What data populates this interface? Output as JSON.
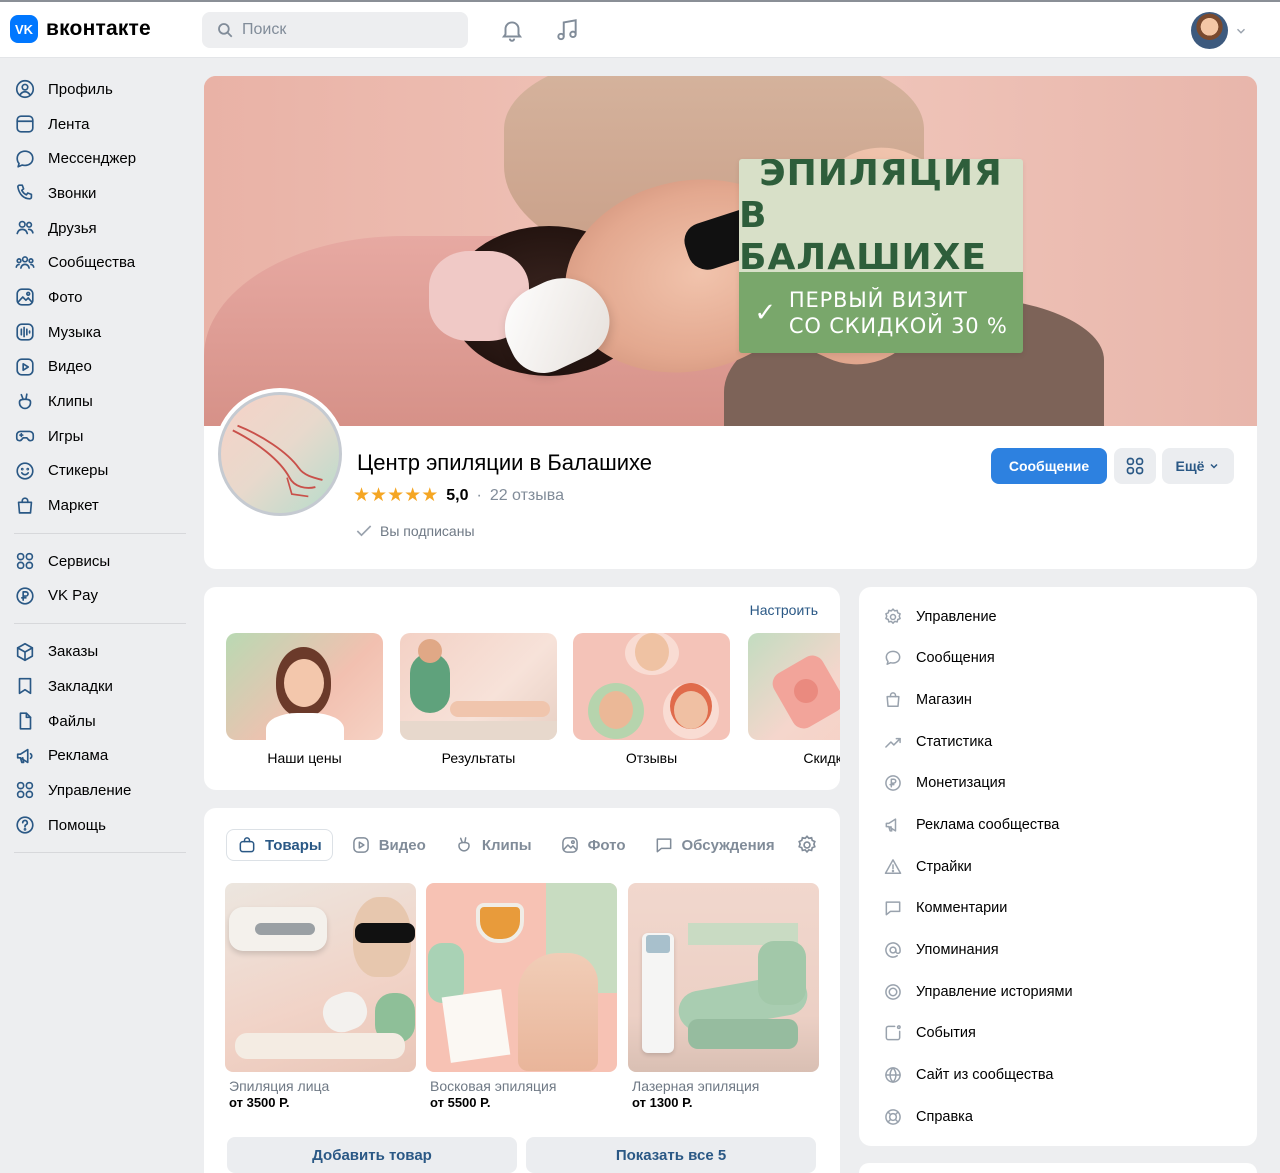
{
  "header": {
    "logo_text": "вконтакте",
    "logo_mark": "VK",
    "search_placeholder": "Поиск",
    "icons": [
      "search-icon",
      "bell-icon",
      "music-icon",
      "chevron-down-icon"
    ]
  },
  "sidebar": {
    "items": [
      {
        "label": "Профиль",
        "icon": "profile-icon"
      },
      {
        "label": "Лента",
        "icon": "feed-icon"
      },
      {
        "label": "Мессенджер",
        "icon": "messenger-icon"
      },
      {
        "label": "Звонки",
        "icon": "phone-icon"
      },
      {
        "label": "Друзья",
        "icon": "friends-icon"
      },
      {
        "label": "Сообщества",
        "icon": "communities-icon"
      },
      {
        "label": "Фото",
        "icon": "photo-icon"
      },
      {
        "label": "Музыка",
        "icon": "music-icon"
      },
      {
        "label": "Видео",
        "icon": "video-icon"
      },
      {
        "label": "Клипы",
        "icon": "clips-icon"
      },
      {
        "label": "Игры",
        "icon": "games-icon"
      },
      {
        "label": "Стикеры",
        "icon": "stickers-icon"
      },
      {
        "label": "Маркет",
        "icon": "market-icon"
      }
    ],
    "items2": [
      {
        "label": "Сервисы",
        "icon": "services-icon"
      },
      {
        "label": "VK Pay",
        "icon": "vkpay-icon"
      }
    ],
    "items3": [
      {
        "label": "Заказы",
        "icon": "orders-icon"
      },
      {
        "label": "Закладки",
        "icon": "bookmarks-icon"
      },
      {
        "label": "Файлы",
        "icon": "files-icon"
      },
      {
        "label": "Реклама",
        "icon": "ads-icon"
      },
      {
        "label": "Управление",
        "icon": "manage-icon"
      },
      {
        "label": "Помощь",
        "icon": "help-icon"
      }
    ]
  },
  "cover": {
    "promo_line1": "ЭПИЛЯЦИЯ",
    "promo_line2": "В БАЛАШИХЕ",
    "promo_line3": "ПЕРВЫЙ ВИЗИТ",
    "promo_line4": "СО СКИДКОЙ 30 %",
    "promo_check": "✓"
  },
  "group": {
    "name": "Центр эпиляции в Балашихе",
    "rating": "5,0",
    "stars": 5,
    "reviews": "22 отзыва",
    "subscribed": "Вы подписаны",
    "btn_message": "Сообщение",
    "btn_more": "Ещё"
  },
  "links": {
    "configure": "Настроить",
    "items": [
      {
        "label": "Наши цены"
      },
      {
        "label": "Результаты"
      },
      {
        "label": "Отзывы"
      },
      {
        "label": "Скидки"
      }
    ]
  },
  "products": {
    "tabs": [
      {
        "label": "Товары",
        "icon": "bag-icon",
        "active": true
      },
      {
        "label": "Видео",
        "icon": "video-icon"
      },
      {
        "label": "Клипы",
        "icon": "clips-icon"
      },
      {
        "label": "Фото",
        "icon": "photo-icon"
      },
      {
        "label": "Обсуждения",
        "icon": "discussion-icon"
      }
    ],
    "items": [
      {
        "name": "Эпиляция лица",
        "price": "от 3500 Р."
      },
      {
        "name": "Восковая эпиляция",
        "price": "от 5500 Р."
      },
      {
        "name": "Лазерная эпиляция",
        "price": "от 1300 Р."
      }
    ],
    "btn_add": "Добавить товар",
    "btn_show_all": "Показать все 5"
  },
  "menu": {
    "items": [
      {
        "label": "Управление",
        "icon": "gear-icon"
      },
      {
        "label": "Сообщения",
        "icon": "message-icon"
      },
      {
        "label": "Магазин",
        "icon": "shop-icon"
      },
      {
        "label": "Статистика",
        "icon": "stats-icon"
      },
      {
        "label": "Монетизация",
        "icon": "ruble-icon"
      },
      {
        "label": "Реклама сообщества",
        "icon": "megaphone-icon"
      },
      {
        "label": "Страйки",
        "icon": "warning-icon"
      },
      {
        "label": "Комментарии",
        "icon": "comment-icon"
      },
      {
        "label": "Упоминания",
        "icon": "at-icon"
      },
      {
        "label": "Управление историями",
        "icon": "stories-icon"
      },
      {
        "label": "События",
        "icon": "events-icon"
      },
      {
        "label": "Сайт из сообщества",
        "icon": "globe-icon"
      },
      {
        "label": "Справка",
        "icon": "help-ring-icon"
      }
    ]
  },
  "colors": {
    "accent": "#2d81e0",
    "link": "#2a5885",
    "page_bg": "#edeef0",
    "promo_green": "#79a76b",
    "promo_light": "#d8e0c8",
    "star": "#f5a623"
  }
}
